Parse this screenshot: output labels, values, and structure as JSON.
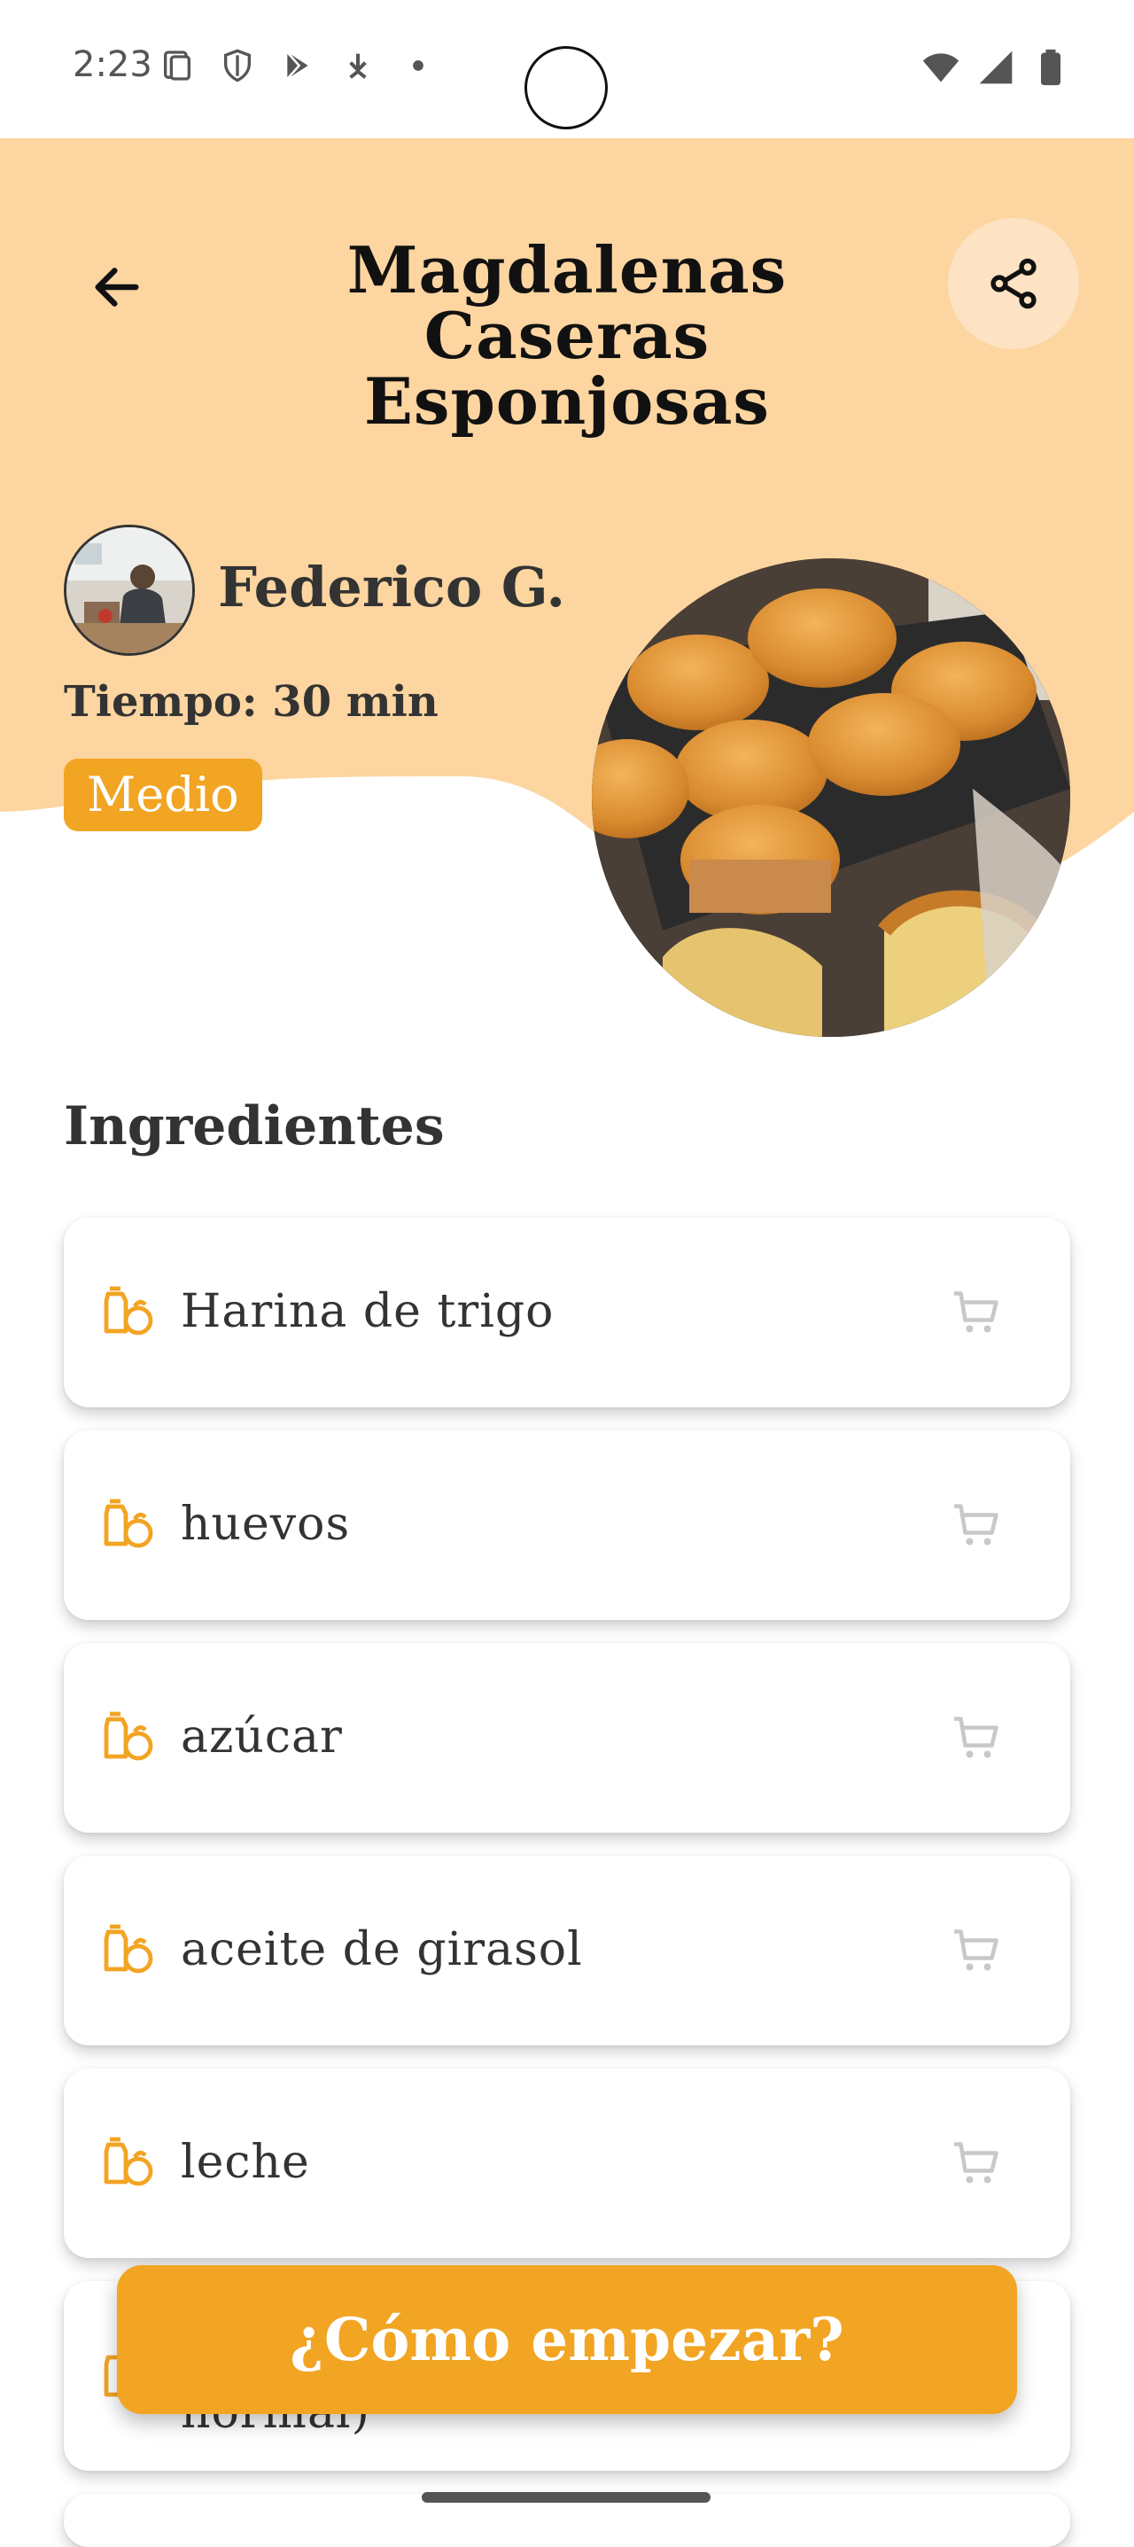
{
  "status_bar": {
    "time": "2:23"
  },
  "header": {
    "title": "Magdalenas Caseras Esponjosas",
    "title_line1": "Magdalenas Caseras",
    "title_line2": "Esponjosas",
    "back_icon": "arrow-left-icon",
    "share_icon": "share-icon"
  },
  "recipe": {
    "author": "Federico G.",
    "time": "Tiempo: 30 min",
    "difficulty": "Medio"
  },
  "ingredients": {
    "section_title": "Ingredientes",
    "items": [
      {
        "name": "Harina de trigo"
      },
      {
        "name": "huevos"
      },
      {
        "name": "azúcar"
      },
      {
        "name": "aceite de girasol"
      },
      {
        "name": "leche"
      },
      {
        "name": "normal)"
      }
    ]
  },
  "cta": {
    "label": "¿Cómo empezar?"
  },
  "colors": {
    "header_bg": "#fdd5a0",
    "accent": "#f2a423",
    "share_bg": "#fde3c3"
  }
}
